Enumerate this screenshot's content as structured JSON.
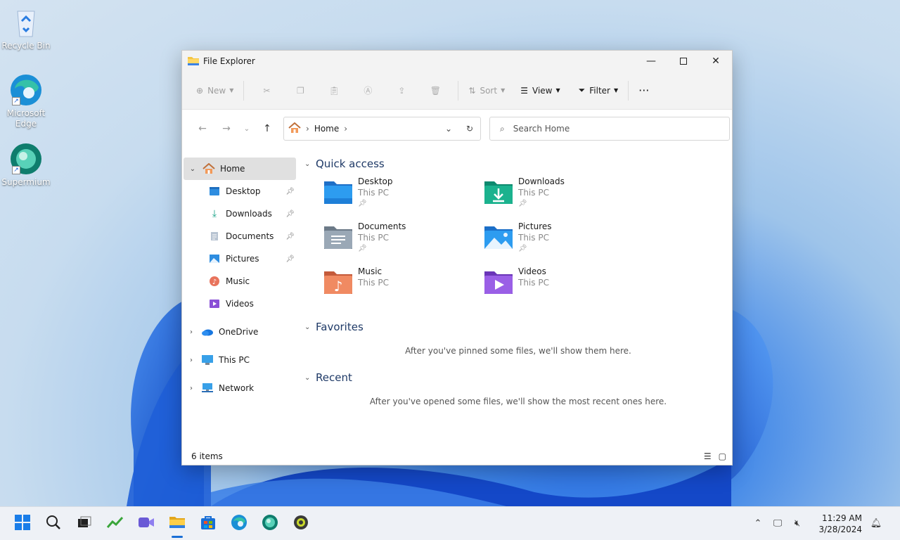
{
  "desktop": {
    "icons": [
      {
        "label": "Recycle Bin"
      },
      {
        "label": "Microsoft Edge"
      },
      {
        "label": "Supermium"
      }
    ]
  },
  "window": {
    "title": "File Explorer",
    "toolbar": {
      "new_label": "New",
      "sort_label": "Sort",
      "view_label": "View",
      "filter_label": "Filter"
    },
    "address": {
      "crumb": "Home",
      "search_placeholder": "Search Home"
    },
    "sidebar": {
      "home": "Home",
      "pinned": [
        {
          "label": "Desktop"
        },
        {
          "label": "Downloads"
        },
        {
          "label": "Documents"
        },
        {
          "label": "Pictures"
        }
      ],
      "unpinned": [
        {
          "label": "Music"
        },
        {
          "label": "Videos"
        }
      ],
      "roots": [
        {
          "label": "OneDrive"
        },
        {
          "label": "This PC"
        },
        {
          "label": "Network"
        }
      ]
    },
    "quick_access": {
      "heading": "Quick access",
      "items": [
        {
          "name": "Desktop",
          "location": "This PC",
          "pinned": true
        },
        {
          "name": "Downloads",
          "location": "This PC",
          "pinned": true
        },
        {
          "name": "Documents",
          "location": "This PC",
          "pinned": true
        },
        {
          "name": "Pictures",
          "location": "This PC",
          "pinned": true
        },
        {
          "name": "Music",
          "location": "This PC",
          "pinned": false
        },
        {
          "name": "Videos",
          "location": "This PC",
          "pinned": false
        }
      ]
    },
    "favorites": {
      "heading": "Favorites",
      "empty": "After you've pinned some files, we'll show them here."
    },
    "recent": {
      "heading": "Recent",
      "empty": "After you've opened some files, we'll show the most recent ones here."
    },
    "status": {
      "count": "6 items"
    }
  },
  "taskbar": {
    "time": "11:29 AM",
    "date": "3/28/2024"
  },
  "colors": {
    "accent": "#1a6fd6",
    "folder_yellow": "#f4c542",
    "selection": "#e0e0e0"
  }
}
